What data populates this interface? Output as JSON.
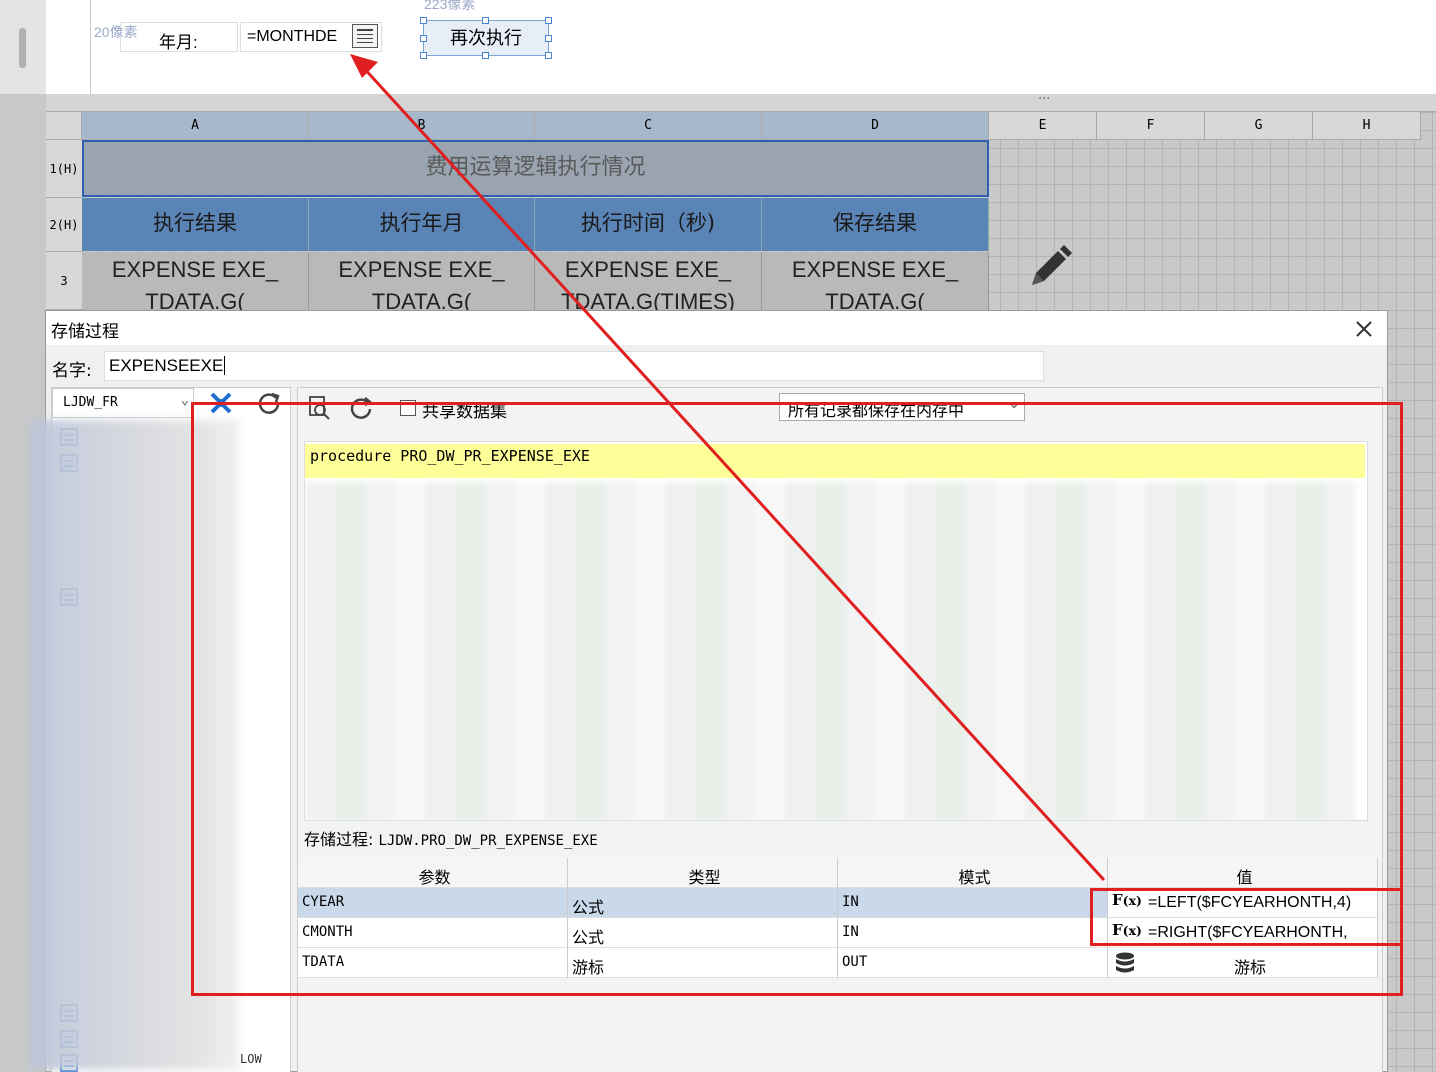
{
  "form": {
    "px_label_left": "20像素",
    "px_label_top": "223像素",
    "year_month_label": "年月:",
    "year_month_value": "=MONTHDE",
    "exec_button": "再次执行"
  },
  "sheet": {
    "columns": [
      "A",
      "B",
      "C",
      "D",
      "E",
      "F",
      "G",
      "H"
    ],
    "rows": [
      "1(H)",
      "2(H)",
      "3"
    ],
    "title": "费用运算逻辑执行情况",
    "headers": [
      "执行结果",
      "执行年月",
      "执行时间（秒)",
      "保存结果"
    ],
    "data_cells": [
      [
        "EXPENSE EXE_",
        "TDATA.G("
      ],
      [
        "EXPENSE EXE_",
        "TDATA.G("
      ],
      [
        "EXPENSE EXE_",
        "TDATA.G(TIMES)"
      ],
      [
        "EXPENSE EXE_",
        "TDATA.G("
      ]
    ]
  },
  "dialog": {
    "title": "存储过程",
    "name_label": "名字:",
    "name_value": "EXPENSEEXE",
    "datasource": "LJDW_FR",
    "share_dataset_label": "共享数据集",
    "mode_select": "所有记录都保存在内存中",
    "code_line1": "procedure PRO_DW_PR_EXPENSE_EXE",
    "proc_label": "存储过程:",
    "proc_name": "LJDW.PRO_DW_PR_EXPENSE_EXE",
    "low_text": "LOW",
    "params": {
      "headers": [
        "参数",
        "类型",
        "模式",
        "值"
      ],
      "rows": [
        {
          "name": "CYEAR",
          "type": "公式",
          "mode": "IN",
          "value": "=LEFT($FCYEARHONTH,4)"
        },
        {
          "name": "CMONTH",
          "type": "公式",
          "mode": "IN",
          "value": "=RIGHT($FCYEARHONTH,"
        },
        {
          "name": "TDATA",
          "type": "游标",
          "mode": "OUT",
          "value": "游标"
        }
      ]
    }
  },
  "colors": {
    "accent_red": "#e02020",
    "header_blue": "#5b84b6",
    "selected_row": "#c9d9ea"
  }
}
